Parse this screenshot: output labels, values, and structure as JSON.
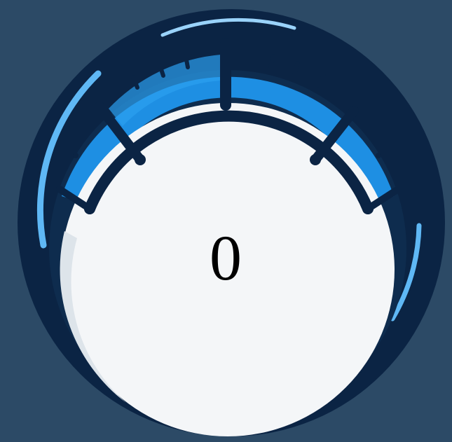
{
  "gauge": {
    "value": "0",
    "colors": {
      "background": "#2c4a66",
      "bezel": "#0b2444",
      "dial_face": "#f4f6f8",
      "scale_fill": "#1e8fe3",
      "highlight": "#5fb8f5"
    },
    "icon": "speedometer-gauge"
  }
}
